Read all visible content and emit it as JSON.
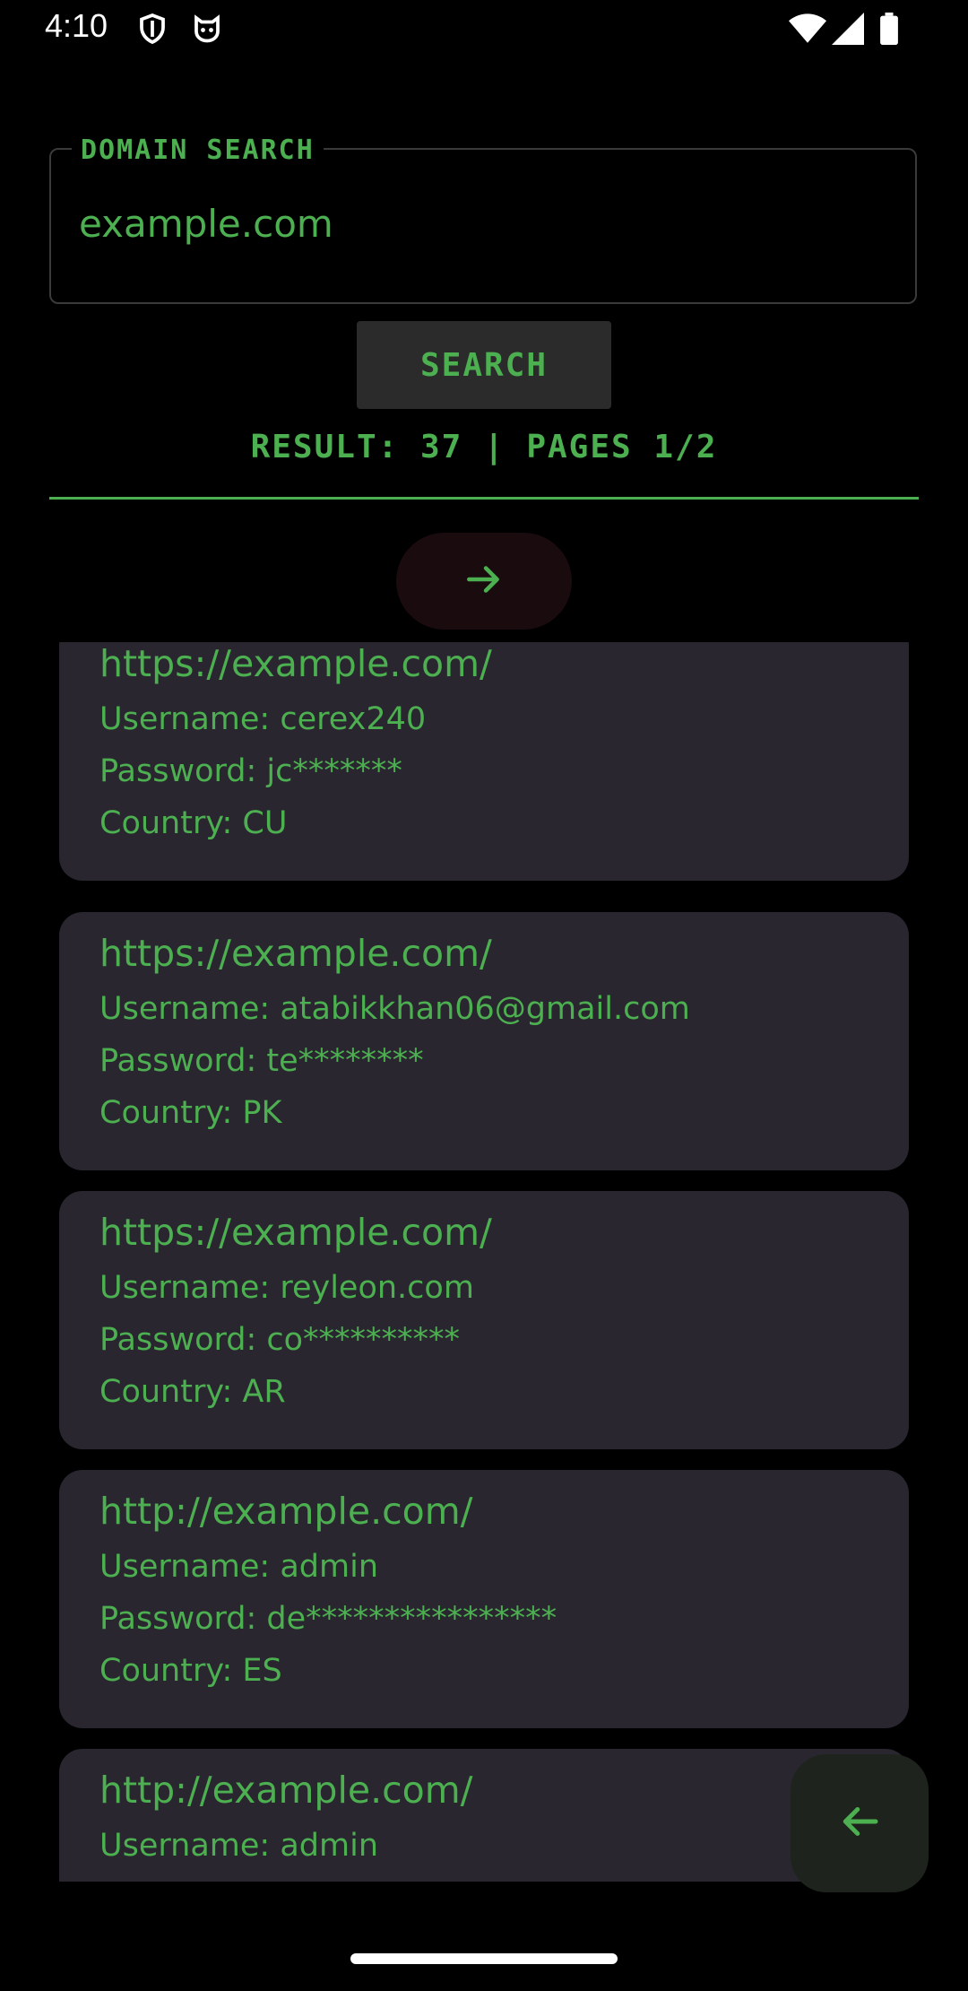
{
  "status": {
    "time": "4:10"
  },
  "search": {
    "label": "DOMAIN SEARCH",
    "value": "example.com",
    "button": "SEARCH"
  },
  "result": {
    "text": "RESULT: 37 | PAGES 1/2"
  },
  "icons": {
    "next": "arrow-right-icon",
    "back": "arrow-left-icon"
  },
  "colors": {
    "accent": "#4caf50",
    "card": "#2a2630",
    "background": "#000000"
  },
  "results": [
    {
      "url": "https://example.com/",
      "username": "Username: cerex240",
      "password": "Password: jc*******",
      "country": "Country: CU"
    },
    {
      "url": "https://example.com/",
      "username": "Username: atabikkhan06@gmail.com",
      "password": "Password: te********",
      "country": "Country: PK"
    },
    {
      "url": "https://example.com/",
      "username": "Username: reyleon.com",
      "password": "Password: co**********",
      "country": "Country: AR"
    },
    {
      "url": "http://example.com/",
      "username": "Username: admin",
      "password": "Password: de****************",
      "country": "Country: ES"
    },
    {
      "url": "http://example.com/",
      "username": "Username: admin",
      "password": "",
      "country": ""
    }
  ]
}
